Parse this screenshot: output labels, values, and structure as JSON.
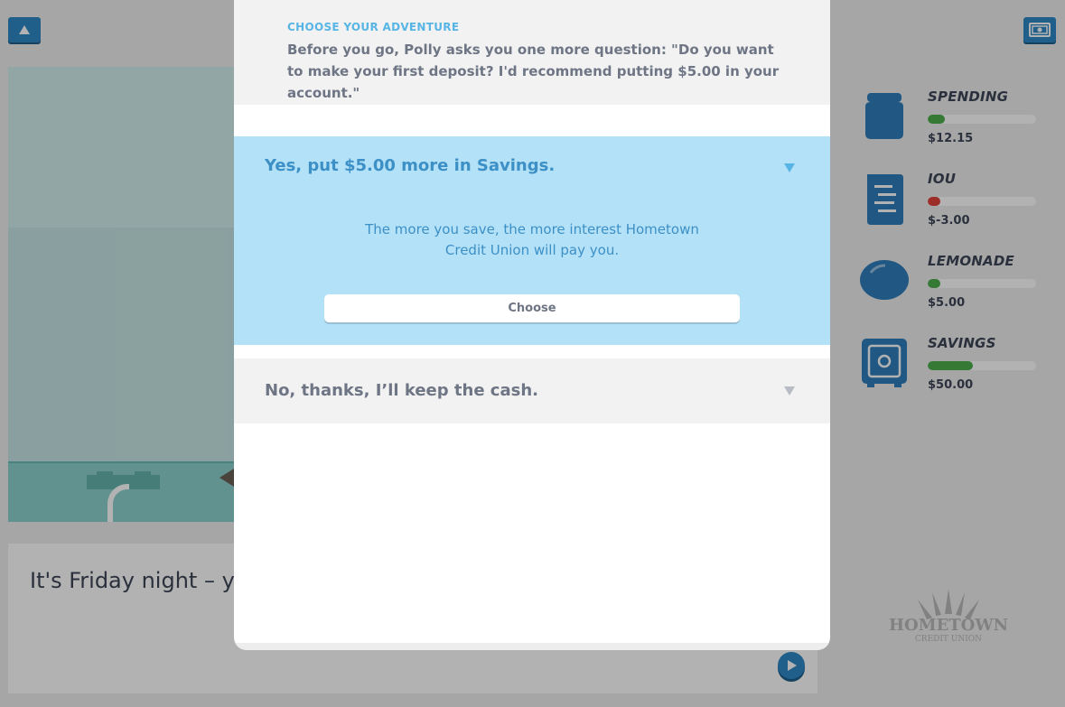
{
  "topbar": {
    "menu_icon": "triangle-up-icon",
    "cash_icon": "money-bill-icon"
  },
  "story": {
    "text": "It's Friday night – you have to get up early for the Waterpark tomorrow.",
    "play_icon": "play-icon"
  },
  "sidebar": {
    "items": [
      {
        "label": "SPENDING",
        "amount": "$12.15",
        "icon": "jar-icon",
        "fill_percent": 16,
        "color": "#4cae4c"
      },
      {
        "label": "IOU",
        "amount": "$-3.00",
        "icon": "receipt-icon",
        "fill_percent": 12,
        "color": "#e0413a"
      },
      {
        "label": "LEMONADE",
        "amount": "$5.00",
        "icon": "lemon-icon",
        "fill_percent": 12,
        "color": "#4cae4c"
      },
      {
        "label": "SAVINGS",
        "amount": "$50.00",
        "icon": "safe-icon",
        "fill_percent": 42,
        "color": "#4cae4c"
      }
    ],
    "accent_icon_color": "#2f7fbc"
  },
  "logo": {
    "text": "HOMETOWN",
    "sub": "CREDIT UNION"
  },
  "modal": {
    "eyebrow": "CHOOSE YOUR ADVENTURE",
    "question": "Before you go, Polly asks you one more question: \"Do you want to make your first deposit? I'd recommend putting $5.00 in your account.\"",
    "options": [
      {
        "title": "Yes, put $5.00 more in Savings.",
        "description": "The more you save, the more interest Hometown Credit Union will pay you.",
        "button_label": "Choose",
        "expanded": true
      },
      {
        "title": "No, thanks, I’ll keep the cash.",
        "expanded": false
      }
    ],
    "colors": {
      "accent": "#57b5e5",
      "open_bg": "#b3e1f8",
      "open_text": "#3d90c6",
      "muted_text": "#6e7584"
    }
  }
}
